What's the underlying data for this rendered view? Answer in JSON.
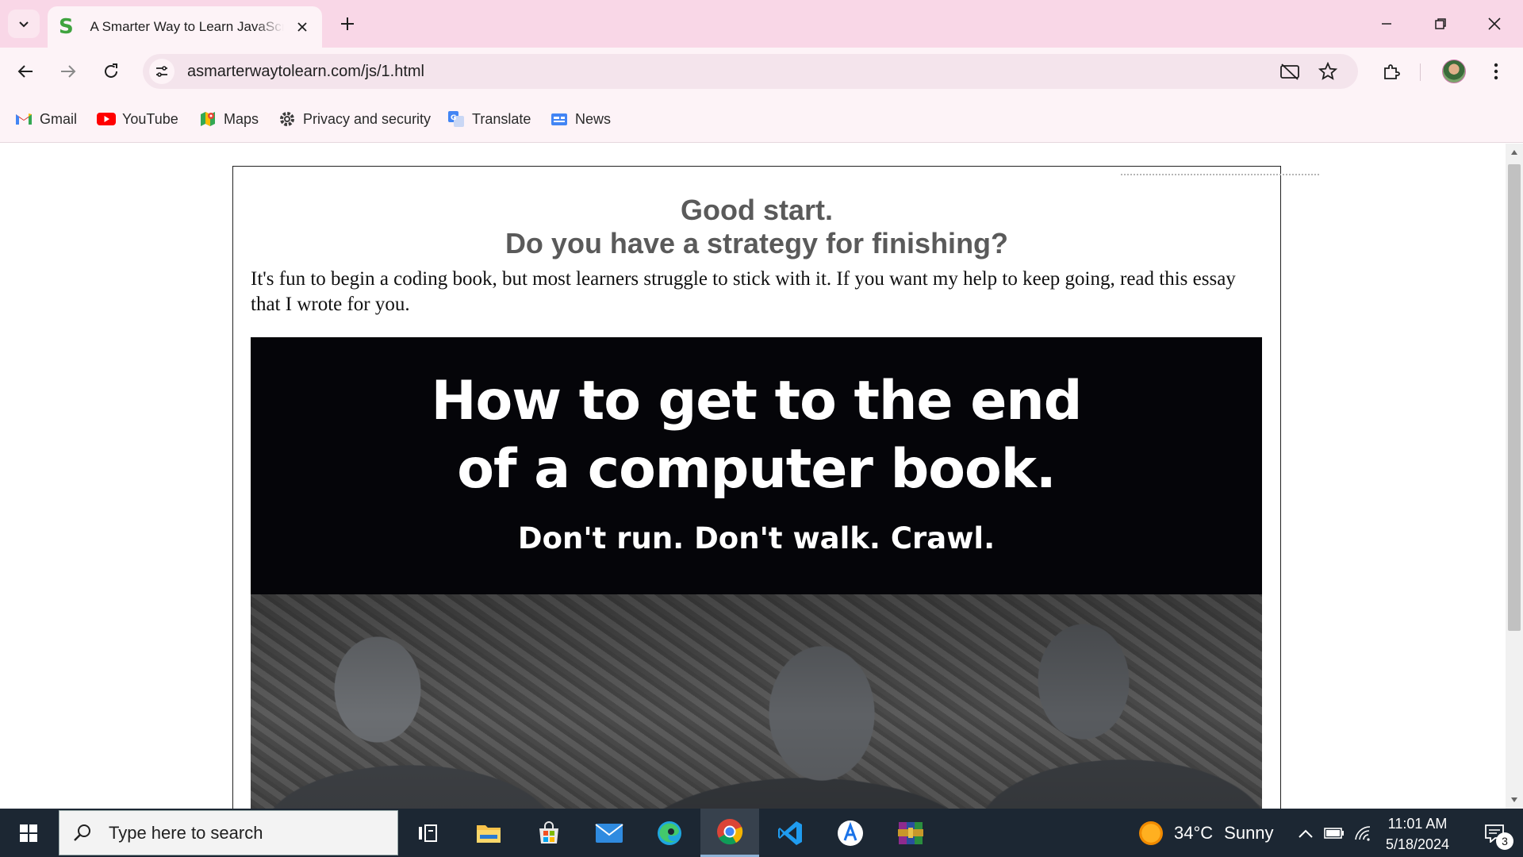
{
  "browser": {
    "tab": {
      "title": "A Smarter Way to Learn JavaScript",
      "favicon": "S"
    },
    "url": "asmarterwaytolearn.com/js/1.html",
    "bookmarks": [
      {
        "label": "Gmail",
        "icon": "gmail-icon"
      },
      {
        "label": "YouTube",
        "icon": "youtube-icon"
      },
      {
        "label": "Maps",
        "icon": "maps-icon"
      },
      {
        "label": "Privacy and security",
        "icon": "gear-icon"
      },
      {
        "label": "Translate",
        "icon": "translate-icon"
      },
      {
        "label": "News",
        "icon": "news-icon"
      }
    ]
  },
  "page": {
    "heading_line1": "Good start.",
    "heading_line2": "Do you have a strategy for finishing?",
    "intro": "It's fun to begin a coding book, but most learners struggle to stick with it. If you want my help to keep going, read this essay that I wrote for you.",
    "banner": {
      "title_line1": "How to get to the end",
      "title_line2": "of a computer book.",
      "subtitle": "Don't run. Don't walk. Crawl."
    }
  },
  "taskbar": {
    "search_placeholder": "Type here to search",
    "weather": {
      "temp": "34°C",
      "condition": "Sunny"
    },
    "time": "11:01 AM",
    "date": "5/18/2024",
    "notification_count": "3"
  },
  "colors": {
    "tabstrip": "#f9d7e7",
    "toolbar": "#fdf3f7",
    "heading": "#5a5a5a",
    "taskbar": "#1c2733"
  }
}
